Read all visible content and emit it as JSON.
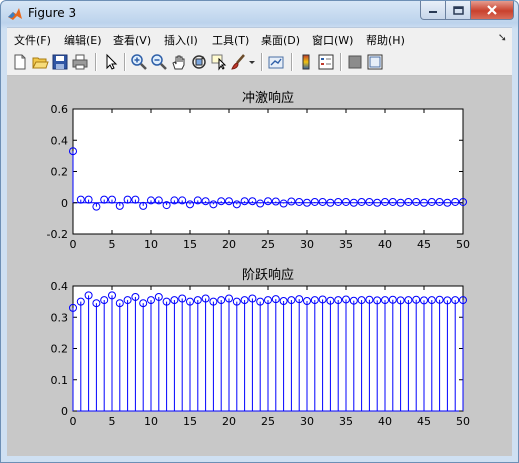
{
  "window": {
    "title": "Figure 3",
    "controls": {
      "minimize": "minimize",
      "maximize": "maximize",
      "close": "close"
    }
  },
  "menu": {
    "items": [
      "文件(F)",
      "编辑(E)",
      "查看(V)",
      "插入(I)",
      "工具(T)",
      "桌面(D)",
      "窗口(W)",
      "帮助(H)"
    ],
    "overflow_icon": "dock-arrow-icon"
  },
  "toolbar": {
    "buttons": [
      "new-figure-icon",
      "open-file-icon",
      "save-icon",
      "print-icon",
      "edit-plot-icon",
      "zoom-in-icon",
      "zoom-out-icon",
      "pan-icon",
      "rotate-3d-icon",
      "data-cursor-icon",
      "brush-icon",
      "link-plot-icon",
      "insert-colorbar-icon",
      "insert-legend-icon",
      "hide-plot-tools-icon",
      "show-plot-tools-icon"
    ]
  },
  "colors": {
    "stem": "#0000ff",
    "figure_bg": "#c8c8c8",
    "axes_bg": "#ffffff"
  },
  "chart_data": [
    {
      "type": "stem",
      "title": "冲激响应",
      "xlabel": "",
      "ylabel": "",
      "xlim": [
        0,
        50
      ],
      "ylim": [
        -0.2,
        0.6
      ],
      "xticks": [
        0,
        5,
        10,
        15,
        20,
        25,
        30,
        35,
        40,
        45,
        50
      ],
      "yticks": [
        -0.2,
        0,
        0.2,
        0.4,
        0.6
      ],
      "ytick_labels": [
        "-0.2",
        "0",
        "0.2",
        "0.4",
        "0.6"
      ],
      "grid": false,
      "x": [
        0,
        1,
        2,
        3,
        4,
        5,
        6,
        7,
        8,
        9,
        10,
        11,
        12,
        13,
        14,
        15,
        16,
        17,
        18,
        19,
        20,
        21,
        22,
        23,
        24,
        25,
        26,
        27,
        28,
        29,
        30,
        31,
        32,
        33,
        34,
        35,
        36,
        37,
        38,
        39,
        40,
        41,
        42,
        43,
        44,
        45,
        46,
        47,
        48,
        49,
        50
      ],
      "values": [
        0.33,
        0.02,
        0.02,
        -0.025,
        0.02,
        0.02,
        -0.02,
        0.02,
        0.02,
        -0.02,
        0.015,
        0.015,
        -0.015,
        0.015,
        0.015,
        -0.01,
        0.015,
        0.01,
        -0.01,
        0.01,
        0.01,
        -0.01,
        0.01,
        0.01,
        -0.005,
        0.01,
        0.008,
        -0.005,
        0.008,
        0.005,
        0,
        0.005,
        0.005,
        0,
        0.005,
        0.005,
        0,
        0.005,
        0.005,
        0,
        0.005,
        0.005,
        0,
        0.005,
        0.005,
        0,
        0.005,
        0.005,
        0,
        0.005,
        0.005
      ]
    },
    {
      "type": "stem",
      "title": "阶跃响应",
      "xlabel": "",
      "ylabel": "",
      "xlim": [
        0,
        50
      ],
      "ylim": [
        0,
        0.4
      ],
      "xticks": [
        0,
        5,
        10,
        15,
        20,
        25,
        30,
        35,
        40,
        45,
        50
      ],
      "yticks": [
        0,
        0.1,
        0.2,
        0.3,
        0.4
      ],
      "ytick_labels": [
        "0",
        "0.1",
        "0.2",
        "0.3",
        "0.4"
      ],
      "grid": false,
      "x": [
        0,
        1,
        2,
        3,
        4,
        5,
        6,
        7,
        8,
        9,
        10,
        11,
        12,
        13,
        14,
        15,
        16,
        17,
        18,
        19,
        20,
        21,
        22,
        23,
        24,
        25,
        26,
        27,
        28,
        29,
        30,
        31,
        32,
        33,
        34,
        35,
        36,
        37,
        38,
        39,
        40,
        41,
        42,
        43,
        44,
        45,
        46,
        47,
        48,
        49,
        50
      ],
      "values": [
        0.33,
        0.35,
        0.37,
        0.345,
        0.355,
        0.37,
        0.345,
        0.355,
        0.365,
        0.345,
        0.355,
        0.365,
        0.35,
        0.355,
        0.36,
        0.35,
        0.355,
        0.36,
        0.35,
        0.355,
        0.36,
        0.35,
        0.355,
        0.36,
        0.35,
        0.355,
        0.358,
        0.352,
        0.355,
        0.358,
        0.352,
        0.355,
        0.357,
        0.353,
        0.355,
        0.357,
        0.353,
        0.355,
        0.356,
        0.354,
        0.355,
        0.356,
        0.354,
        0.355,
        0.356,
        0.354,
        0.355,
        0.356,
        0.354,
        0.355,
        0.355
      ]
    }
  ]
}
